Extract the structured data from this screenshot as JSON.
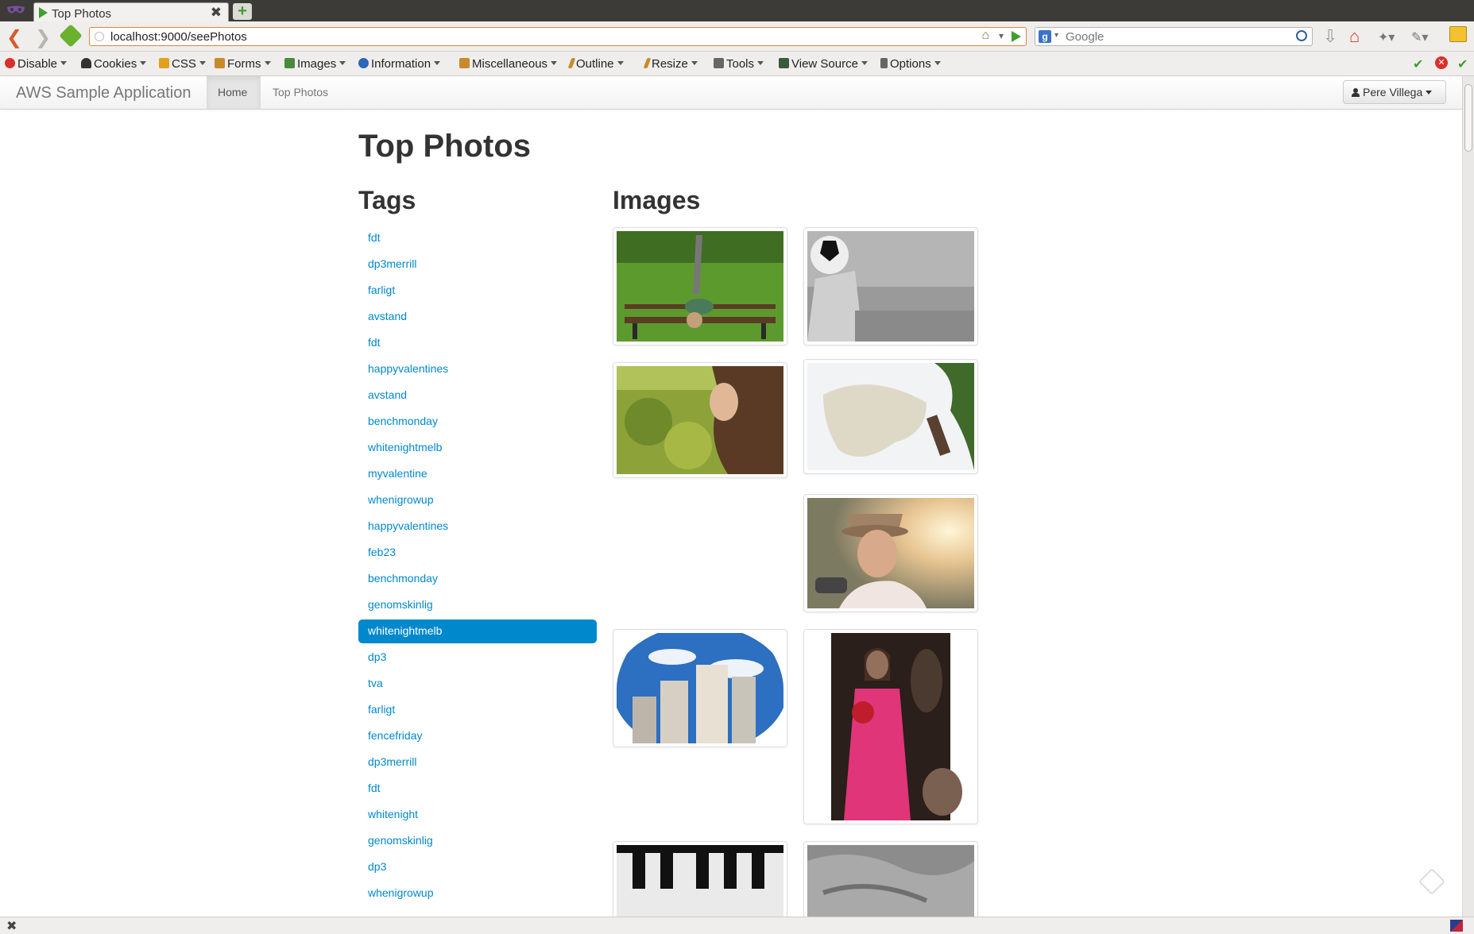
{
  "browser": {
    "tab_title": "Top Photos",
    "url": "localhost:9000/seePhotos",
    "search_placeholder": "Google",
    "search_engine_label": "g"
  },
  "devtoolbar": {
    "items": [
      {
        "label": "Disable",
        "icon": "disable-icon",
        "color": "#d9302c"
      },
      {
        "label": "Cookies",
        "icon": "cookies-icon",
        "color": "#333333"
      },
      {
        "label": "CSS",
        "icon": "css-icon",
        "color": "#e0a020"
      },
      {
        "label": "Forms",
        "icon": "forms-icon",
        "color": "#c98a2b"
      },
      {
        "label": "Images",
        "icon": "images-icon",
        "color": "#4a8a3a"
      },
      {
        "label": "Information",
        "icon": "information-icon",
        "color": "#2c66b8"
      },
      {
        "label": "Miscellaneous",
        "icon": "miscellaneous-icon",
        "color": "#c98a2b"
      },
      {
        "label": "Outline",
        "icon": "outline-icon",
        "color": "#c98a2b"
      },
      {
        "label": "Resize",
        "icon": "resize-icon",
        "color": "#c98a2b"
      },
      {
        "label": "Tools",
        "icon": "tools-icon",
        "color": "#555555"
      },
      {
        "label": "View Source",
        "icon": "view-source-icon",
        "color": "#3a5a3a"
      },
      {
        "label": "Options",
        "icon": "options-icon",
        "color": "#666666"
      }
    ]
  },
  "app": {
    "brand": "AWS Sample Application",
    "tabs": [
      {
        "label": "Home",
        "active": true
      },
      {
        "label": "Top Photos",
        "active": false
      }
    ],
    "user": "Pere Villega"
  },
  "main": {
    "title": "Top Photos",
    "tags_heading": "Tags",
    "images_heading": "Images",
    "tags": [
      {
        "label": "fdt"
      },
      {
        "label": "dp3merrill"
      },
      {
        "label": "farligt"
      },
      {
        "label": "avstand"
      },
      {
        "label": "fdt"
      },
      {
        "label": "happyvalentines"
      },
      {
        "label": "avstand"
      },
      {
        "label": "benchmonday"
      },
      {
        "label": "whitenightmelb"
      },
      {
        "label": "myvalentine"
      },
      {
        "label": "whenigrowup"
      },
      {
        "label": "happyvalentines"
      },
      {
        "label": "feb23"
      },
      {
        "label": "benchmonday"
      },
      {
        "label": "genomskinlig"
      },
      {
        "label": "whitenightmelb",
        "active": true
      },
      {
        "label": "dp3"
      },
      {
        "label": "tva"
      },
      {
        "label": "farligt"
      },
      {
        "label": "fencefriday"
      },
      {
        "label": "dp3merrill"
      },
      {
        "label": "fdt"
      },
      {
        "label": "whitenight"
      },
      {
        "label": "genomskinlig"
      },
      {
        "label": "dp3"
      },
      {
        "label": "whenigrowup"
      }
    ],
    "images": [
      {
        "name": "photo-woman-on-bench"
      },
      {
        "name": "photo-soccer-ball-wall"
      },
      {
        "name": "photo-woman-in-garden"
      },
      {
        "name": "photo-floating-cloth"
      },
      {
        "name": "photo-man-in-hat-sunset"
      },
      {
        "name": "photo-city-fisheye"
      },
      {
        "name": "photo-girl-pink-dress"
      },
      {
        "name": "photo-piano-keys"
      },
      {
        "name": "photo-bedsheets"
      }
    ]
  },
  "colors": {
    "link": "#0088cc",
    "active_tag_bg": "#0088cc",
    "url_border": "#e3843a"
  }
}
